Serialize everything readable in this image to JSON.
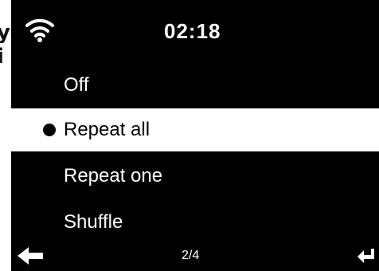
{
  "edge_fragments": [
    {
      "text": "y"
    },
    {
      "text": "i"
    }
  ],
  "status": {
    "clock": "02:18",
    "wifi_icon": "wifi-icon"
  },
  "menu": {
    "items": [
      {
        "label": "Off",
        "selected": false
      },
      {
        "label": "Repeat all",
        "selected": true
      },
      {
        "label": "Repeat one",
        "selected": false
      },
      {
        "label": "Shuffle",
        "selected": false
      }
    ]
  },
  "footer": {
    "back_icon": "arrow-left-icon",
    "page_indicator": "2/4",
    "enter_icon": "enter-return-icon"
  },
  "colors": {
    "screen_background": "#000000",
    "text": "#ffffff",
    "selected_background": "#ffffff",
    "selected_text": "#000000"
  }
}
